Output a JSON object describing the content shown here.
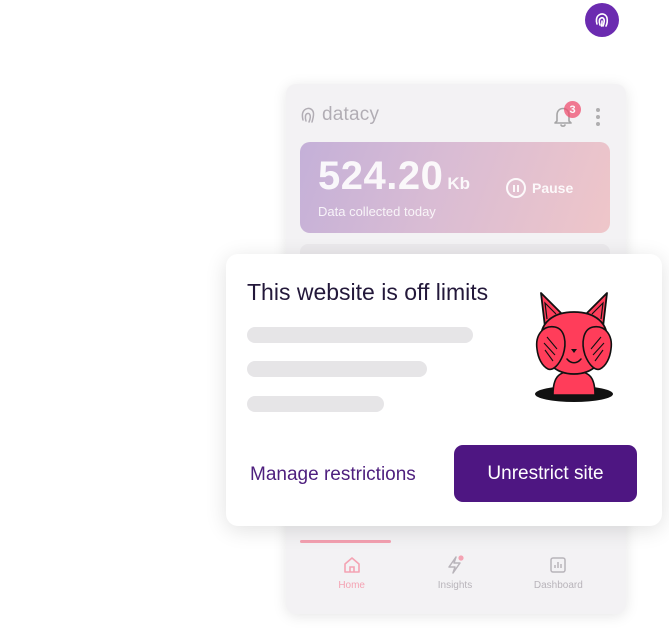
{
  "extension": {
    "icon": "fingerprint-icon",
    "color": "#6b2bb0"
  },
  "header": {
    "brand_name": "datacy",
    "notification_count": "3",
    "menu_icon": "kebab-icon"
  },
  "stats": {
    "value": "524.20",
    "unit": "Kb",
    "label": "Data collected today",
    "pause_label": "Pause"
  },
  "nav": {
    "active": "Home",
    "tabs": [
      {
        "label": "Home",
        "icon": "home-icon"
      },
      {
        "label": "Insights",
        "icon": "lightning-icon"
      },
      {
        "label": "Dashboard",
        "icon": "chart-icon"
      }
    ]
  },
  "modal": {
    "title": "This website is off limits",
    "manage_label": "Manage restrictions",
    "unrestrict_label": "Unrestrict site",
    "mascot": "fox-covering-eyes-illustration"
  },
  "colors": {
    "primary": "#4e1682",
    "accent": "#ff3d5a",
    "badge": "#f05070",
    "text": "#23183a"
  }
}
